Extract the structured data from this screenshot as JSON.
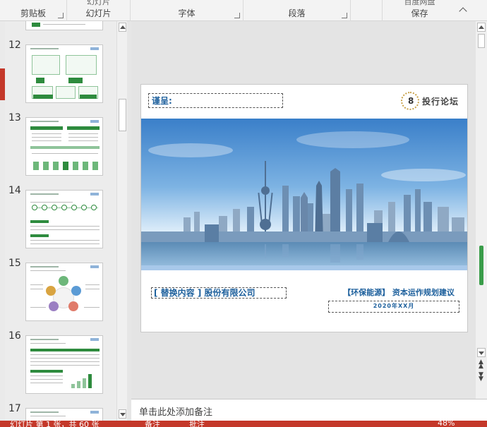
{
  "ribbon": {
    "groups": [
      {
        "label": "剪贴板",
        "peek": ""
      },
      {
        "label": "幻灯片",
        "peek": "幻灯片"
      },
      {
        "label": "字体",
        "peek": ""
      },
      {
        "label": "段落",
        "peek": ""
      },
      {
        "label": "",
        "peek": ""
      },
      {
        "label": "保存",
        "peek": "百度网盘"
      }
    ]
  },
  "thumbnails": [
    {
      "num": "12"
    },
    {
      "num": "13"
    },
    {
      "num": "14"
    },
    {
      "num": "15"
    },
    {
      "num": "16"
    },
    {
      "num": "17"
    }
  ],
  "slide": {
    "to_label": "谨呈:",
    "logo_digit": "8",
    "logo_text": "投行论坛",
    "company": "[ 替换内容 ] 股份有限公司",
    "proposal_bracket": "【环保能源】",
    "proposal_rest": "资本运作规划建议",
    "date": "2020年XX月"
  },
  "notes": {
    "placeholder": "单击此处添加备注"
  },
  "status": {
    "slide_info": "幻灯片 第 1 张，共 60 张",
    "notes_btn": "备注",
    "comments_btn": "批注",
    "zoom": "48%"
  },
  "colors": {
    "accent_green": "#2e8b3e",
    "title_blue": "#1c5f9c",
    "status_red": "#c4382a"
  }
}
